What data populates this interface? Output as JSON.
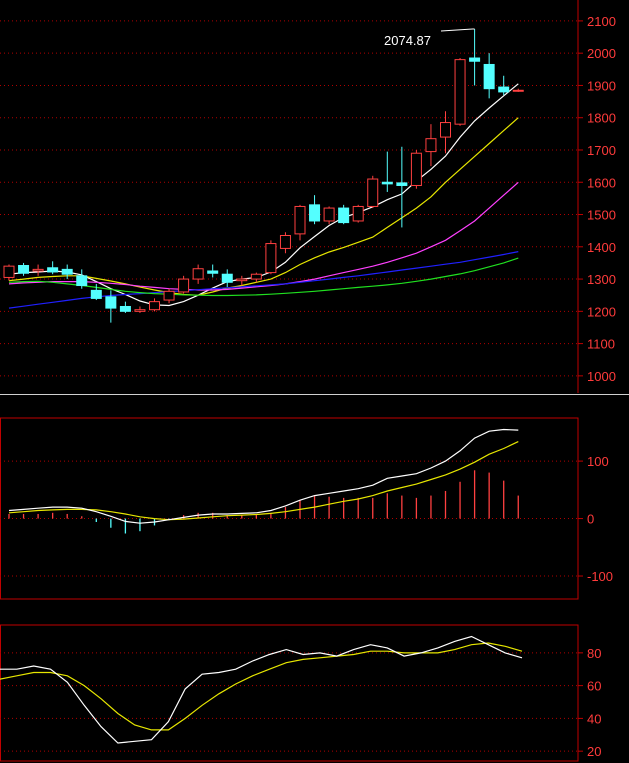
{
  "colors": {
    "background": "#000000",
    "axis": "#c00000",
    "axis_text": "#ff3b3b",
    "grid": "#b00000",
    "separator": "#d0d0d0",
    "up_candle": "#ff4040",
    "down_candle": "#54ffff",
    "ma5": "#ffffff",
    "ma10": "#e6e600",
    "ma20": "#ff40ff",
    "ma60": "#2020ff",
    "ma120": "#20e020",
    "macd_dif": "#ffffff",
    "macd_dea": "#e6e600",
    "macd_hist_pos": "#ff4040",
    "macd_hist_neg": "#54ffff",
    "kdj_k": "#ffffff",
    "kdj_d": "#e6e600"
  },
  "chart_data": [
    {
      "type": "candlestick",
      "y_ticks": [
        "2100",
        "2000",
        "1900",
        "1800",
        "1700",
        "1600",
        "1500",
        "1400",
        "1300",
        "1200",
        "1100",
        "1000"
      ],
      "y_tick_values": [
        2100,
        2000,
        1900,
        1800,
        1700,
        1600,
        1500,
        1400,
        1300,
        1200,
        1100,
        1000
      ],
      "ylim": [
        950,
        2140
      ],
      "max_annotation": "2074.87",
      "max_value": 2074.87,
      "grid": true,
      "candles": [
        {
          "o": 1305,
          "h": 1345,
          "l": 1295,
          "c": 1340
        },
        {
          "o": 1342,
          "h": 1350,
          "l": 1310,
          "c": 1318
        },
        {
          "o": 1325,
          "h": 1345,
          "l": 1310,
          "c": 1330
        },
        {
          "o": 1335,
          "h": 1355,
          "l": 1315,
          "c": 1322
        },
        {
          "o": 1330,
          "h": 1345,
          "l": 1300,
          "c": 1315
        },
        {
          "o": 1310,
          "h": 1330,
          "l": 1270,
          "c": 1280
        },
        {
          "o": 1265,
          "h": 1285,
          "l": 1235,
          "c": 1240
        },
        {
          "o": 1245,
          "h": 1265,
          "l": 1165,
          "c": 1210
        },
        {
          "o": 1215,
          "h": 1230,
          "l": 1195,
          "c": 1200
        },
        {
          "o": 1200,
          "h": 1215,
          "l": 1195,
          "c": 1205
        },
        {
          "o": 1205,
          "h": 1240,
          "l": 1200,
          "c": 1230
        },
        {
          "o": 1235,
          "h": 1270,
          "l": 1225,
          "c": 1262
        },
        {
          "o": 1260,
          "h": 1310,
          "l": 1255,
          "c": 1300
        },
        {
          "o": 1300,
          "h": 1345,
          "l": 1285,
          "c": 1332
        },
        {
          "o": 1325,
          "h": 1345,
          "l": 1305,
          "c": 1318
        },
        {
          "o": 1315,
          "h": 1330,
          "l": 1275,
          "c": 1290
        },
        {
          "o": 1295,
          "h": 1310,
          "l": 1280,
          "c": 1300
        },
        {
          "o": 1300,
          "h": 1320,
          "l": 1290,
          "c": 1315
        },
        {
          "o": 1320,
          "h": 1420,
          "l": 1315,
          "c": 1410
        },
        {
          "o": 1395,
          "h": 1445,
          "l": 1380,
          "c": 1435
        },
        {
          "o": 1440,
          "h": 1530,
          "l": 1420,
          "c": 1525
        },
        {
          "o": 1530,
          "h": 1560,
          "l": 1470,
          "c": 1480
        },
        {
          "o": 1480,
          "h": 1525,
          "l": 1470,
          "c": 1520
        },
        {
          "o": 1520,
          "h": 1530,
          "l": 1470,
          "c": 1475
        },
        {
          "o": 1480,
          "h": 1530,
          "l": 1475,
          "c": 1525
        },
        {
          "o": 1525,
          "h": 1620,
          "l": 1520,
          "c": 1610
        },
        {
          "o": 1600,
          "h": 1695,
          "l": 1570,
          "c": 1595
        },
        {
          "o": 1598,
          "h": 1710,
          "l": 1460,
          "c": 1590
        },
        {
          "o": 1590,
          "h": 1700,
          "l": 1580,
          "c": 1690
        },
        {
          "o": 1695,
          "h": 1780,
          "l": 1650,
          "c": 1735
        },
        {
          "o": 1740,
          "h": 1820,
          "l": 1690,
          "c": 1785
        },
        {
          "o": 1780,
          "h": 1985,
          "l": 1775,
          "c": 1980
        },
        {
          "o": 1985,
          "h": 2074.87,
          "l": 1900,
          "c": 1975
        },
        {
          "o": 1965,
          "h": 2000,
          "l": 1860,
          "c": 1890
        },
        {
          "o": 1895,
          "h": 1930,
          "l": 1870,
          "c": 1880
        },
        {
          "o": 1885,
          "h": 1890,
          "l": 1880,
          "c": 1885
        }
      ],
      "series": [
        {
          "key": "ma5",
          "values": [
            1315,
            1320,
            1322,
            1325,
            1322,
            1313,
            1292,
            1270,
            1252,
            1232,
            1220,
            1218,
            1230,
            1250,
            1272,
            1292,
            1300,
            1305,
            1322,
            1352,
            1397,
            1432,
            1466,
            1491,
            1506,
            1524,
            1546,
            1564,
            1604,
            1640,
            1681,
            1740,
            1790,
            1830,
            1868,
            1905
          ]
        },
        {
          "key": "ma10",
          "values": [
            1295,
            1300,
            1305,
            1308,
            1310,
            1310,
            1302,
            1294,
            1285,
            1275,
            1266,
            1258,
            1252,
            1250,
            1260,
            1272,
            1280,
            1290,
            1300,
            1320,
            1345,
            1366,
            1384,
            1398,
            1414,
            1430,
            1460,
            1490,
            1520,
            1555,
            1600,
            1640,
            1680,
            1720,
            1760,
            1800
          ]
        },
        {
          "key": "ma20",
          "values": [
            1285,
            1288,
            1290,
            1292,
            1292,
            1292,
            1290,
            1287,
            1283,
            1278,
            1274,
            1270,
            1268,
            1266,
            1266,
            1268,
            1272,
            1276,
            1280,
            1285,
            1292,
            1300,
            1310,
            1320,
            1330,
            1340,
            1352,
            1366,
            1380,
            1400,
            1420,
            1450,
            1480,
            1520,
            1560,
            1600
          ]
        },
        {
          "key": "ma60",
          "values": [
            1210,
            1216,
            1222,
            1228,
            1234,
            1240,
            1245,
            1249,
            1252,
            1255,
            1258,
            1261,
            1264,
            1267,
            1270,
            1273,
            1276,
            1279,
            1282,
            1285,
            1290,
            1295,
            1300,
            1305,
            1310,
            1316,
            1322,
            1328,
            1334,
            1340,
            1346,
            1352,
            1360,
            1368,
            1376,
            1385
          ]
        },
        {
          "key": "ma120",
          "values": [
            1290,
            1292,
            1293,
            1290,
            1285,
            1280,
            1274,
            1268,
            1262,
            1258,
            1255,
            1253,
            1251,
            1250,
            1249,
            1249,
            1250,
            1251,
            1253,
            1256,
            1259,
            1262,
            1266,
            1270,
            1274,
            1278,
            1282,
            1287,
            1293,
            1300,
            1308,
            1316,
            1326,
            1338,
            1350,
            1365
          ]
        }
      ]
    },
    {
      "type": "macd",
      "y_ticks": [
        "100",
        "0",
        "-100"
      ],
      "y_tick_values": [
        100,
        0,
        -100
      ],
      "ylim": [
        -140,
        175
      ],
      "grid": true,
      "series": [
        {
          "key": "dif",
          "values": [
            14,
            16,
            18,
            20,
            20,
            18,
            12,
            4,
            -5,
            -8,
            -6,
            -2,
            2,
            6,
            8,
            8,
            9,
            10,
            14,
            22,
            32,
            40,
            44,
            48,
            52,
            58,
            70,
            74,
            78,
            88,
            100,
            118,
            140,
            152,
            155,
            154
          ]
        },
        {
          "key": "dea",
          "values": [
            10,
            12,
            14,
            15,
            16,
            16,
            15,
            12,
            8,
            3,
            0,
            -2,
            -1,
            1,
            3,
            5,
            6,
            7,
            9,
            12,
            16,
            20,
            25,
            30,
            34,
            40,
            48,
            54,
            60,
            68,
            76,
            86,
            98,
            112,
            122,
            134
          ]
        },
        {
          "key": "hist",
          "values": [
            8,
            8,
            8,
            10,
            8,
            4,
            -6,
            -16,
            -26,
            -22,
            -12,
            -2,
            6,
            10,
            10,
            6,
            6,
            6,
            10,
            20,
            32,
            40,
            38,
            36,
            36,
            36,
            44,
            40,
            36,
            40,
            48,
            64,
            84,
            80,
            66,
            40
          ]
        }
      ]
    },
    {
      "type": "kdj",
      "y_ticks": [
        "80",
        "60",
        "40",
        "20"
      ],
      "y_tick_values": [
        80,
        60,
        40,
        20
      ],
      "ylim": [
        14,
        97
      ],
      "grid": true,
      "series": [
        {
          "key": "k",
          "values": [
            70,
            70,
            72,
            70,
            62,
            48,
            35,
            25,
            26,
            27,
            38,
            58,
            67,
            68,
            70,
            75,
            79,
            82,
            79,
            80,
            78,
            82,
            85,
            83,
            78,
            80,
            83,
            87,
            90,
            85,
            80,
            77
          ]
        },
        {
          "key": "d",
          "values": [
            64,
            66,
            68,
            68,
            66,
            60,
            52,
            43,
            36,
            33,
            33,
            40,
            48,
            55,
            61,
            66,
            70,
            74,
            76,
            77,
            78,
            79,
            81,
            81,
            80,
            80,
            80,
            82,
            85,
            86,
            84,
            81
          ]
        }
      ]
    }
  ]
}
